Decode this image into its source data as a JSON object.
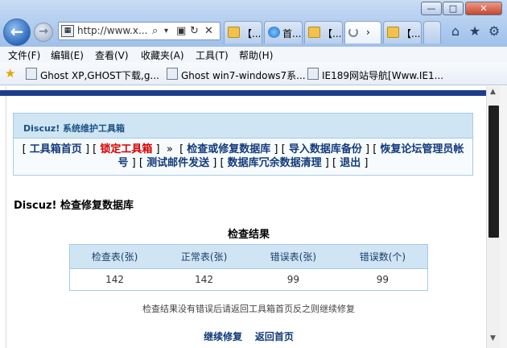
{
  "browser": {
    "window_controls": {
      "minimize": "—",
      "maximize": "□",
      "close": "✕"
    },
    "back_icon": "back-arrow-icon",
    "forward_icon": "forward-arrow-icon",
    "url": "http://www.x...",
    "tabs": [
      {
        "label": "【...",
        "icon": "note-icon"
      },
      {
        "label": "首...",
        "icon": "ie-icon"
      },
      {
        "label": "【...",
        "icon": "note-icon"
      },
      {
        "label": "›",
        "icon": "loading-icon"
      },
      {
        "label": "【...",
        "icon": "note-icon"
      }
    ],
    "menu": [
      "文件(F)",
      "编辑(E)",
      "查看(V)",
      "收藏夹(A)",
      "工具(T)",
      "帮助(H)"
    ],
    "favorites": [
      "Ghost XP,GHOST下载,g...",
      "Ghost win7-windows7系...",
      "IE189网站导航[Www.IE1..."
    ]
  },
  "toolbox": {
    "title": "Discuz! 系统维护工具箱",
    "links": [
      "工具箱首页",
      "锁定工具箱",
      "检查或修复数据库",
      "导入数据库备份",
      "恢复论坛管理员帐号",
      "测试邮件发送",
      "数据库冗余数据清理",
      "退出"
    ],
    "separator_arrow": "»"
  },
  "section_title": "Discuz! 检查修复数据库",
  "result": {
    "title": "检查结果",
    "headers": [
      "检查表(张)",
      "正常表(张)",
      "错误表(张)",
      "错误数(个)"
    ],
    "values": [
      "142",
      "142",
      "99",
      "99"
    ]
  },
  "hint": "检查结果没有错误后请返回工具箱首页反之则继续修复",
  "actions": {
    "continue": "继续修复",
    "back": "返回首页"
  }
}
